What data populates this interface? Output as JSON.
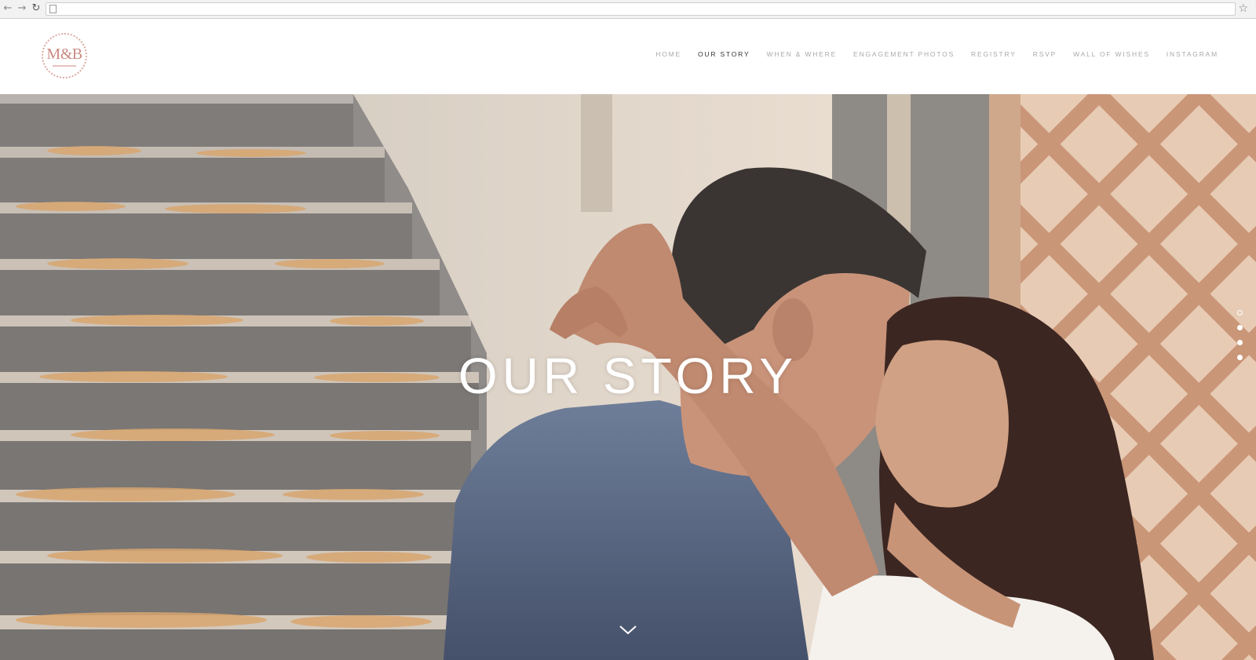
{
  "browser": {
    "icons": [
      "back-arrow-icon",
      "forward-arrow-icon",
      "reload-icon",
      "page-icon",
      "star-icon",
      "menu-icon"
    ]
  },
  "site": {
    "logo_text": "M&B",
    "nav": [
      {
        "label": "HOME",
        "active": false
      },
      {
        "label": "OUR STORY",
        "active": true
      },
      {
        "label": "WHEN & WHERE",
        "active": false
      },
      {
        "label": "ENGAGEMENT PHOTOS",
        "active": false
      },
      {
        "label": "REGISTRY",
        "active": false
      },
      {
        "label": "RSVP",
        "active": false
      },
      {
        "label": "WALL OF WISHES",
        "active": false
      },
      {
        "label": "INSTAGRAM",
        "active": false
      }
    ]
  },
  "hero": {
    "title": "OUR STORY",
    "scroll_icon": "chevron-down-icon",
    "slide_count": 4,
    "current_slide": 1
  },
  "colors": {
    "accent": "#c98b82",
    "nav_text": "#a9a9a9",
    "nav_active": "#333333"
  }
}
